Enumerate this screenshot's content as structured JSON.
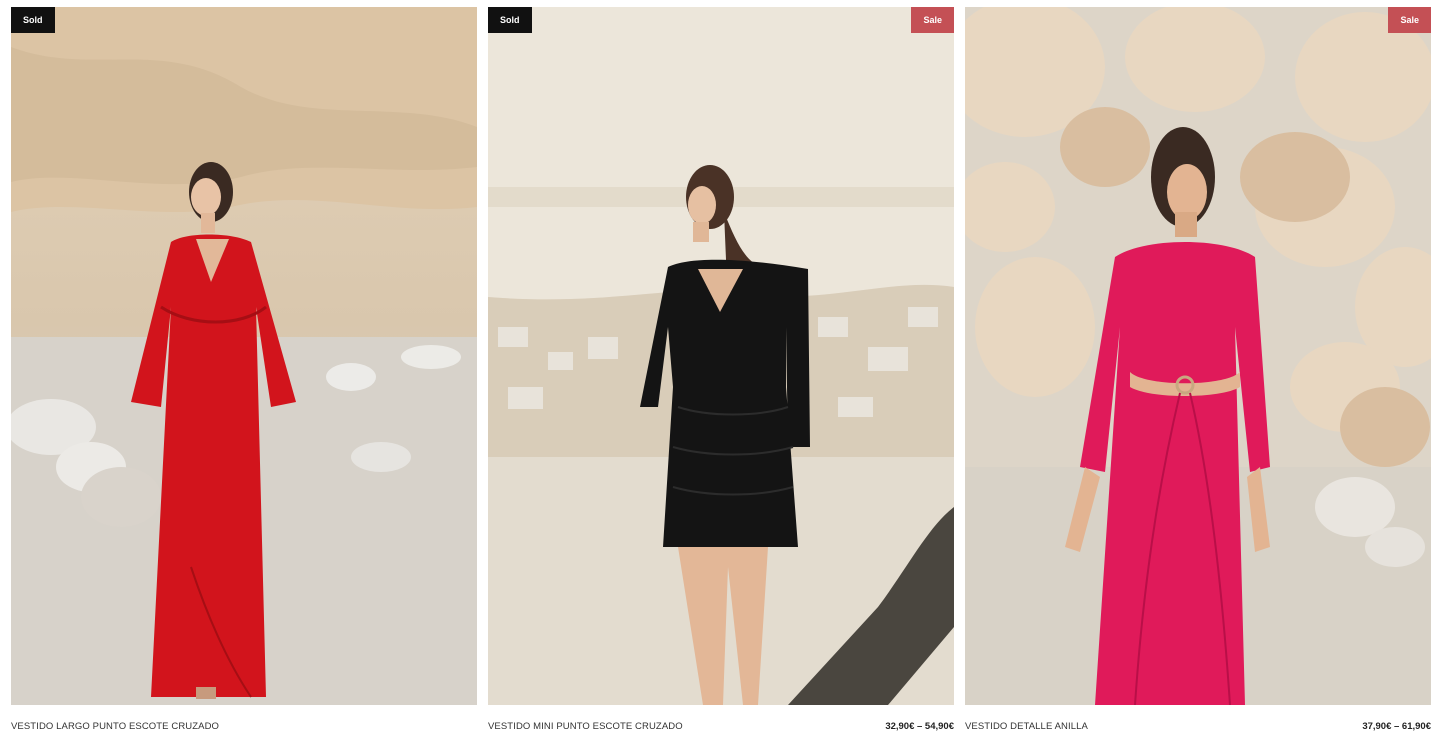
{
  "products": [
    {
      "badge": "Sold",
      "name": "VESTIDO LARGO PUNTO ESCOTE CRUZADO",
      "price": "",
      "image": "model in long red wrap dress in quarry",
      "colors": {
        "badge": "#111111",
        "dress": "#d2141c"
      }
    },
    {
      "badge": "Sold",
      "badge_secondary": "Sale",
      "name": "VESTIDO MINI PUNTO ESCOTE CRUZADO",
      "price": "32,90€ – 54,90€",
      "image": "model in black ruched mini dress in quarry",
      "colors": {
        "badge": "#111111",
        "badge_secondary": "#c45055",
        "dress": "#141414"
      }
    },
    {
      "badge": "Sale",
      "name": "VESTIDO DETALLE ANILLA",
      "price": "37,90€ – 61,90€",
      "image": "model in pink long dress with ring detail in front of rocks",
      "colors": {
        "badge": "#c45055",
        "dress": "#e01a5a"
      }
    }
  ]
}
